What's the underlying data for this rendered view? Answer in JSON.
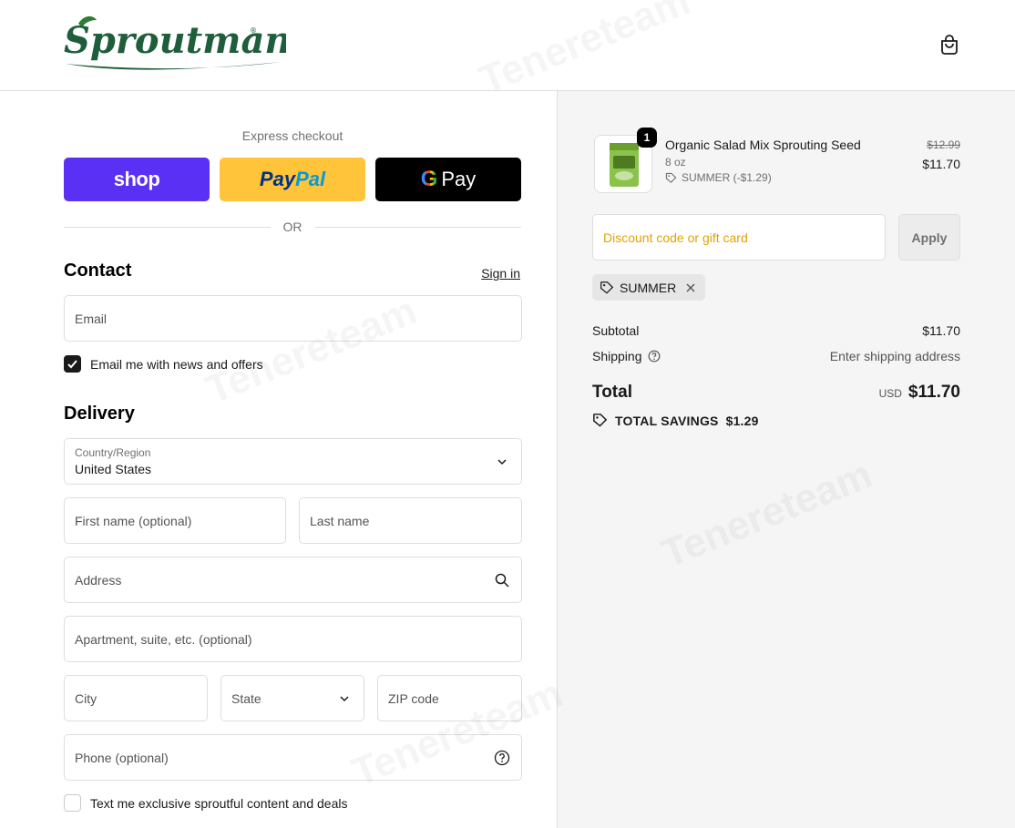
{
  "header": {
    "logo_text": "Sproutman",
    "logo_mark": "®",
    "cart_icon": "shopping-bag-icon"
  },
  "express": {
    "label": "Express checkout",
    "shop_label": "shop",
    "paypal_label_1": "Pay",
    "paypal_label_2": "Pal",
    "gpay_g": "G",
    "gpay_label": "Pay",
    "or_label": "OR"
  },
  "contact": {
    "title": "Contact",
    "signin_label": "Sign in",
    "email_placeholder": "Email",
    "newsletter_label": "Email me with news and offers",
    "newsletter_checked": true
  },
  "delivery": {
    "title": "Delivery",
    "country_label": "Country/Region",
    "country_value": "United States",
    "first_name_placeholder": "First name (optional)",
    "last_name_placeholder": "Last name",
    "address_placeholder": "Address",
    "apartment_placeholder": "Apartment, suite, etc. (optional)",
    "city_placeholder": "City",
    "state_placeholder": "State",
    "zip_placeholder": "ZIP code",
    "phone_placeholder": "Phone (optional)",
    "sms_label": "Text me exclusive sproutful content and deals",
    "sms_checked": false
  },
  "order": {
    "item": {
      "quantity": "1",
      "name": "Organic Salad Mix Sprouting Seed",
      "variant": "8 oz",
      "discount": "SUMMER (-$1.29)",
      "price_original": "$12.99",
      "price_final": "$11.70"
    },
    "discount_placeholder": "Discount code or gift card",
    "apply_label": "Apply",
    "applied_code": "SUMMER",
    "subtotal_label": "Subtotal",
    "subtotal_value": "$11.70",
    "shipping_label": "Shipping",
    "shipping_value": "Enter shipping address",
    "total_label": "Total",
    "total_currency": "USD",
    "total_value": "$11.70",
    "savings_label": "TOTAL SAVINGS",
    "savings_value": "$1.29"
  },
  "watermark": "Tenereteam",
  "colors": {
    "shop": "#5a31f4",
    "paypal": "#ffc439",
    "gpay": "#000000",
    "logo_green": "#1f5e3a",
    "discount_placeholder": "#e0a300"
  }
}
